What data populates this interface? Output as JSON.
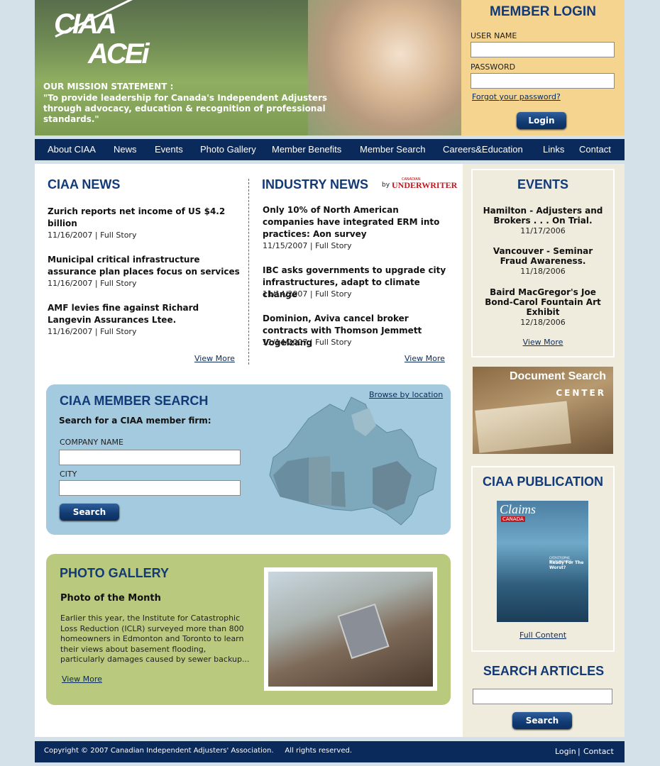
{
  "header": {
    "logo_top": "CIAA",
    "logo_bottom": "ACEi",
    "mission_title": "OUR MISSION STATEMENT :",
    "mission_text": "\"To provide leadership for Canada's Independent Adjusters through advocacy, education & recognition of professional standards.\""
  },
  "login": {
    "title": "MEMBER LOGIN",
    "username_label": "USER NAME",
    "password_label": "PASSWORD",
    "forgot_link": "Forgot your password?",
    "button": "Login"
  },
  "nav": [
    "About CIAA",
    "News",
    "Events",
    "Photo Gallery",
    "Member Benefits",
    "Member Search",
    "Careers&Education",
    "Links",
    "Contact"
  ],
  "ciaa_news": {
    "title": "CIAA NEWS",
    "items": [
      {
        "headline": "Zurich reports net income of US $4.2 billion",
        "meta": "11/16/2007 | Full Story"
      },
      {
        "headline": "Municipal critical infrastructure assurance plan places focus on services",
        "meta": "11/16/2007 | Full Story"
      },
      {
        "headline": "AMF levies fine against Richard Langevin Assurances Ltee.",
        "meta": "11/16/2007 | Full Story"
      }
    ],
    "view_more": "View More"
  },
  "industry_news": {
    "title": "INDUSTRY NEWS",
    "by": "by",
    "brand_small": "CANADIAN",
    "brand": "UNDERWRITER",
    "items": [
      {
        "headline": "Only 10% of North American companies have integrated ERM into practices: Aon survey",
        "meta": "11/15/2007 | Full Story"
      },
      {
        "headline": "IBC asks governments to upgrade city infrastructures, adapt to climate change",
        "meta": "11/14/2007 | Full Story"
      },
      {
        "headline": "Dominion, Aviva cancel broker contracts with Thomson Jemmett Vogelzang",
        "meta": "11/14/2007 | Full Story"
      }
    ],
    "view_more": "View More"
  },
  "member_search": {
    "title": "CIAA MEMBER SEARCH",
    "browse": "Browse by location",
    "subtitle": "Search for a CIAA member firm:",
    "company_label": "COMPANY NAME",
    "city_label": "CITY",
    "button": "Search"
  },
  "photo_gallery": {
    "title": "PHOTO GALLERY",
    "subtitle": "Photo of the Month",
    "text": "Earlier this year, the Institute for Catastrophic Loss Reduction (ICLR) surveyed more than 800 homeowners in Edmonton and Toronto to learn their views about basement flooding, particularly damages caused by sewer backup...",
    "view_more": "View More"
  },
  "events": {
    "title": "EVENTS",
    "items": [
      {
        "title": "Hamilton - Adjusters and Brokers . . . On Trial.",
        "date": "11/17/2006"
      },
      {
        "title": "Vancouver - Seminar Fraud Awareness.",
        "date": "11/18/2006"
      },
      {
        "title": "Baird MacGregor's Joe Bond-Carol Fountain Art Exhibit",
        "date": "12/18/2006"
      }
    ],
    "view_more": "View More"
  },
  "document_search": {
    "line1": "Document Search",
    "line2": "CENTER"
  },
  "publication": {
    "title": "CIAA PUBLICATION",
    "cover_title": "Claims",
    "cover_sub": "CANADA",
    "cover_text1": "CATASTROPHE PREPAREDNESS",
    "cover_text2": "Ready For The Worst?",
    "link": "Full Content"
  },
  "search_articles": {
    "title": "SEARCH ARTICLES",
    "button": "Search"
  },
  "footer": {
    "copyright": "Copyright © 2007 Canadian Independent Adjusters' Association.     All rights reserved.",
    "login": "Login",
    "sep": "|",
    "contact": "Contact"
  }
}
